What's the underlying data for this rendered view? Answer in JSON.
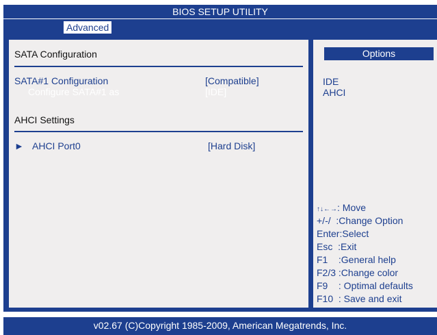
{
  "title": "BIOS SETUP UTILITY",
  "menu": {
    "active_tab": "Advanced"
  },
  "left": {
    "section_title": "SATA Configuration",
    "sata1_label": "SATA#1 Configuration",
    "sata1_value": "[Compatible]",
    "configure_label": "Configure SATA#1 as",
    "configure_value": "[IDE]",
    "ahci_title": "AHCI Settings",
    "arrow": "►",
    "port_label": "AHCI Port0",
    "port_value": "[Hard Disk]"
  },
  "right": {
    "options_header": "Options",
    "options": [
      "IDE",
      "AHCI"
    ],
    "help": [
      {
        "key": "↑↓←→",
        "desc": ": Move"
      },
      {
        "key": "+/-/",
        "desc": "  :Change Option"
      },
      {
        "key": "Enter",
        "desc": ":Select"
      },
      {
        "key": "Esc",
        "desc": "  :Exit"
      },
      {
        "key": "F1",
        "desc": "    :General help"
      },
      {
        "key": "F2/3",
        "desc": " :Change color"
      },
      {
        "key": "F9",
        "desc": "    : Optimal defaults"
      },
      {
        "key": "F10",
        "desc": "  : Save and exit"
      }
    ]
  },
  "footer": "v02.67  (C)Copyright 1985-2009, American Megatrends, Inc.",
  "colors": {
    "bios_blue": "#1d3f8f",
    "panel_bg": "#f0eeee",
    "white": "#ffffff"
  }
}
